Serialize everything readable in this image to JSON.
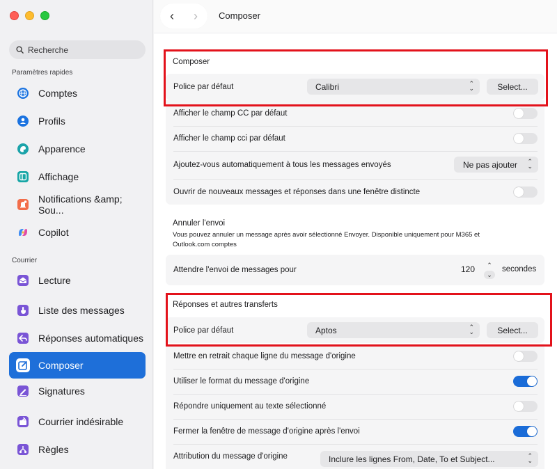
{
  "sidebar": {
    "search_placeholder": "Recherche",
    "sections": [
      {
        "label": "Paramètres rapides"
      },
      {
        "label": "Courrier"
      }
    ],
    "items": [
      {
        "label": "Comptes",
        "icon": "globe-icon",
        "color": "#1b73e0"
      },
      {
        "label": "Profils",
        "icon": "person-icon",
        "color": "#1b73e0"
      },
      {
        "label": "Apparence",
        "icon": "palette-icon",
        "color": "#1ba3a9"
      },
      {
        "label": "Affichage",
        "icon": "layout-icon",
        "color": "#17a6a6"
      },
      {
        "label": "Notifications &amp; Sou...",
        "icon": "bell-icon",
        "color": "#f26d4a"
      },
      {
        "label": "Copilot",
        "icon": "copilot-icon",
        "color": "#7b5cf0"
      },
      {
        "label": "Lecture",
        "icon": "envelope-open-icon",
        "color": "#7a55d6"
      },
      {
        "label": "Liste des messages",
        "icon": "touch-icon",
        "color": "#7a55d6"
      },
      {
        "label": "Réponses automatiques",
        "icon": "reply-icon",
        "color": "#7a55d6"
      },
      {
        "label": "Composer",
        "icon": "compose-icon",
        "color": "#1e6fd9"
      },
      {
        "label": "Signatures",
        "icon": "signature-icon",
        "color": "#7a55d6"
      },
      {
        "label": "Courrier indésirable",
        "icon": "junk-icon",
        "color": "#7a55d6"
      },
      {
        "label": "Règles",
        "icon": "rules-icon",
        "color": "#7a55d6"
      }
    ]
  },
  "header": {
    "title": "Composer"
  },
  "compose": {
    "heading": "Composer",
    "font_label": "Police par défaut",
    "font_value": "Calibri",
    "select_button": "Select...",
    "rows": [
      {
        "label": "Afficher le champ CC par défaut",
        "toggle": false
      },
      {
        "label": "Afficher le champ cci par défaut",
        "toggle": false
      },
      {
        "label": "Ajoutez-vous automatiquement à tous les messages envoyés",
        "value": "Ne pas ajouter"
      },
      {
        "label": "Ouvrir de nouveaux messages et réponses dans une fenêtre distincte",
        "toggle": false
      }
    ]
  },
  "undo_send": {
    "heading": "Annuler l'envoi",
    "description": "Vous pouvez annuler un message après avoir sélectionné Envoyer. Disponible uniquement pour M365 et Outlook.com comptes",
    "row_label": "Attendre l'envoi de messages pour",
    "value": "120",
    "unit": "secondes"
  },
  "replies": {
    "heading": "Réponses et autres transferts",
    "font_label": "Police par défaut",
    "font_value": "Aptos",
    "select_button": "Select...",
    "rows": [
      {
        "label": "Mettre en retrait chaque ligne du message d'origine",
        "toggle": false
      },
      {
        "label": "Utiliser le format du message d'origine",
        "toggle": true
      },
      {
        "label": "Répondre uniquement au texte sélectionné",
        "toggle": false
      },
      {
        "label": "Fermer la fenêtre de message d'origine après l'envoi",
        "toggle": true
      },
      {
        "label": "Attribution du message d'origine",
        "value": "Inclure les lignes From, Date, To et Subject..."
      }
    ]
  },
  "colors": {
    "accent": "#1e6fd9",
    "highlight_border": "#e3121b",
    "toggle_on": "#1a6cd8"
  }
}
